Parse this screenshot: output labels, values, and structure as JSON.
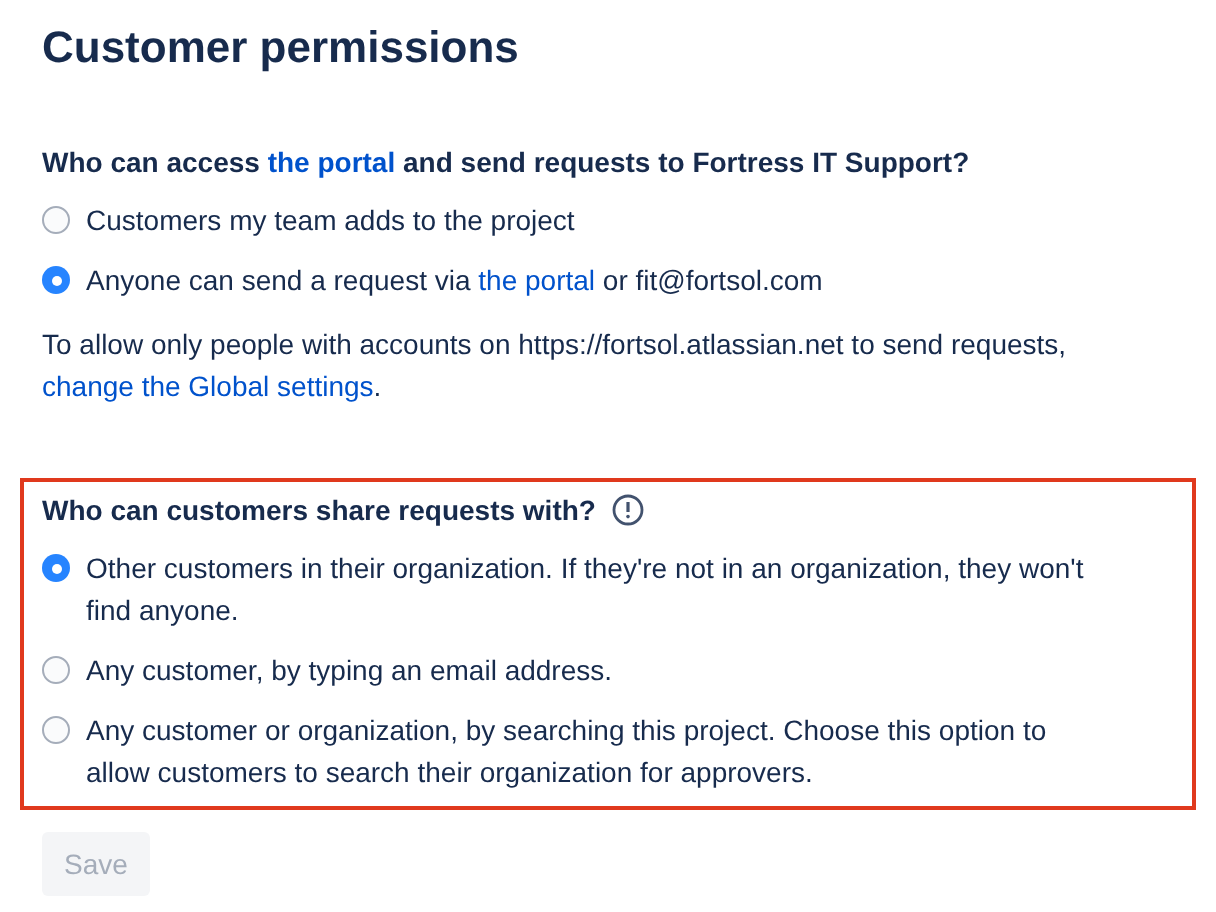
{
  "title": "Customer permissions",
  "sections": [
    {
      "highlighted": false,
      "info": false,
      "question": [
        {
          "kind": "text",
          "text": "Who can access "
        },
        {
          "kind": "link",
          "text": "the portal"
        },
        {
          "kind": "text",
          "text": " and send requests to Fortress IT Support?"
        }
      ],
      "options": [
        {
          "selected": false,
          "parts": [
            {
              "kind": "text",
              "text": "Customers my team adds to the project"
            }
          ]
        },
        {
          "selected": true,
          "parts": [
            {
              "kind": "text",
              "text": "Anyone can send a request via "
            },
            {
              "kind": "link",
              "text": "the portal"
            },
            {
              "kind": "text",
              "text": " or fit@fortsol.com"
            }
          ]
        }
      ],
      "note": [
        {
          "kind": "text",
          "text": "To allow only people with accounts on https://fortsol.atlassian.net to send requests, "
        },
        {
          "kind": "link",
          "text": "change the Global settings"
        },
        {
          "kind": "text",
          "text": "."
        }
      ]
    },
    {
      "highlighted": true,
      "info": true,
      "question": [
        {
          "kind": "text",
          "text": "Who can customers share requests with?"
        }
      ],
      "options": [
        {
          "selected": true,
          "parts": [
            {
              "kind": "text",
              "text": "Other customers in their organization. If they're not in an organization, they won't find anyone."
            }
          ]
        },
        {
          "selected": false,
          "parts": [
            {
              "kind": "text",
              "text": "Any customer, by typing an email address."
            }
          ]
        },
        {
          "selected": false,
          "parts": [
            {
              "kind": "text",
              "text": "Any customer or organization, by searching this project. Choose this option to allow customers to search their organization for approvers."
            }
          ]
        }
      ]
    }
  ],
  "save": {
    "label": "Save",
    "disabled": true
  }
}
